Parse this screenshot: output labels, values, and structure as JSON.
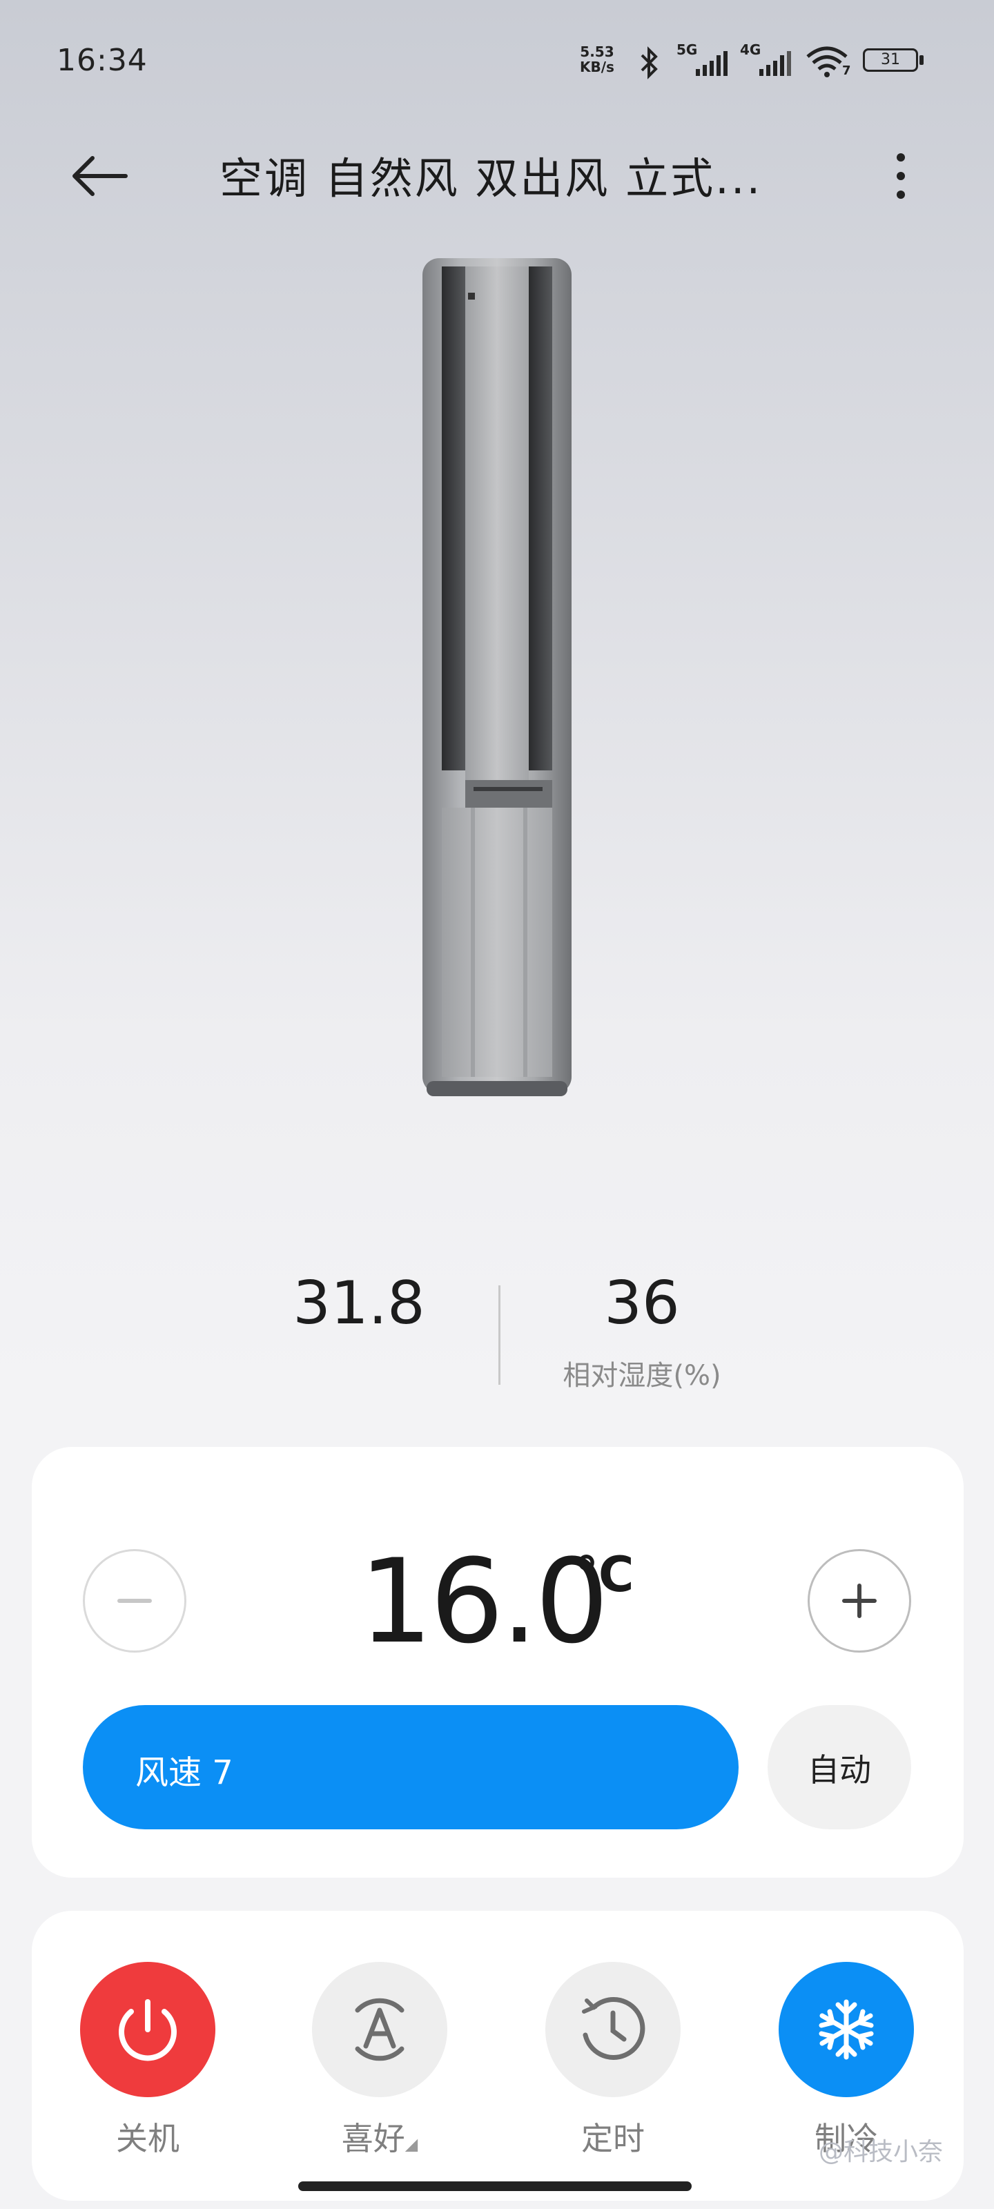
{
  "status_bar": {
    "time": "16:34",
    "net_speed_value": "5.53",
    "net_speed_unit": "KB/s",
    "signal1_label": "5G",
    "signal2_label": "4G",
    "wifi_sub": "7",
    "battery": "31"
  },
  "header": {
    "title": "空调 自然风 双出风 立式...",
    "back_icon": "arrow-left-icon",
    "more_icon": "more-vertical-icon"
  },
  "readings": {
    "temperature": "31.8",
    "humidity": "36",
    "humidity_label": "相对湿度(%)"
  },
  "temp_control": {
    "value": "16.0",
    "unit": "°C",
    "minus_icon": "minus-icon",
    "plus_icon": "plus-icon"
  },
  "fan": {
    "speed_label": "风速 7",
    "speed_level": 7,
    "auto_label": "自动"
  },
  "controls": [
    {
      "label": "关机",
      "icon": "power-icon",
      "color": "#ef3b3d"
    },
    {
      "label": "喜好",
      "icon": "auto-mode-icon",
      "color": "#eeeeee"
    },
    {
      "label": "定时",
      "icon": "timer-icon",
      "color": "#eeeeee"
    },
    {
      "label": "制冷",
      "icon": "snowflake-icon",
      "color": "#0b8ff5"
    }
  ],
  "watermark": "@科技小奈",
  "colors": {
    "accent_blue": "#0b8ff5",
    "power_red": "#ef3b3d"
  }
}
